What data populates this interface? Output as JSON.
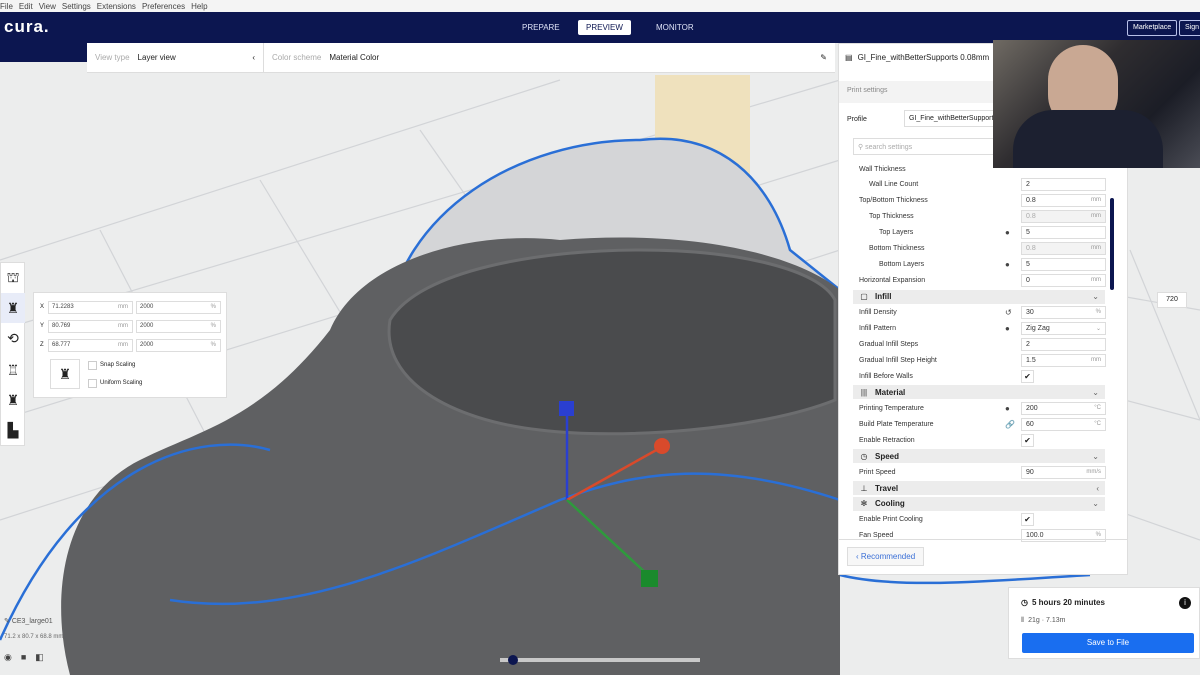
{
  "menu": [
    "File",
    "Edit",
    "View",
    "Settings",
    "Extensions",
    "Preferences",
    "Help"
  ],
  "header": {
    "logo": "cura.",
    "tabs": [
      "PREPARE",
      "PREVIEW",
      "MONITOR"
    ],
    "active_tab": "PREVIEW",
    "marketplace": "Marketplace",
    "signin": "Sign"
  },
  "viewbar": {
    "view_type_label": "View type",
    "view_type": "Layer view",
    "color_scheme_label": "Color scheme",
    "color_scheme": "Material Color"
  },
  "settings": {
    "profile_name": "GI_Fine_withBetterSupports 0.08mm",
    "print_settings": "Print settings",
    "profile_label": "Profile",
    "profile_value": "GI_Fine_withBetterSupports",
    "search_placeholder": "search settings",
    "rows": [
      {
        "type": "s",
        "label": "Wall Thickness",
        "indent": 0
      },
      {
        "type": "s",
        "label": "Wall Line Count",
        "indent": 1,
        "value": "2"
      },
      {
        "type": "s",
        "label": "Top/Bottom Thickness",
        "indent": 0,
        "value": "0.8",
        "unit": "mm"
      },
      {
        "type": "s",
        "label": "Top Thickness",
        "indent": 1,
        "value": "0.8",
        "unit": "mm",
        "disabled": true
      },
      {
        "type": "s",
        "label": "Top Layers",
        "indent": 2,
        "value": "5",
        "icon": "●"
      },
      {
        "type": "s",
        "label": "Bottom Thickness",
        "indent": 1,
        "value": "0.8",
        "unit": "mm",
        "disabled": true
      },
      {
        "type": "s",
        "label": "Bottom Layers",
        "indent": 2,
        "value": "5",
        "icon": "●"
      },
      {
        "type": "s",
        "label": "Horizontal Expansion",
        "indent": 0,
        "value": "0",
        "unit": "mm"
      },
      {
        "type": "c",
        "label": "Infill",
        "icon": "▢",
        "chev": "⌄"
      },
      {
        "type": "s",
        "label": "Infill Density",
        "indent": 0,
        "value": "30",
        "unit": "%",
        "icon": "↺"
      },
      {
        "type": "s",
        "label": "Infill Pattern",
        "indent": 0,
        "value": "Zig Zag",
        "unit": "⌄",
        "icon": "●"
      },
      {
        "type": "s",
        "label": "Gradual Infill Steps",
        "indent": 0,
        "value": "2"
      },
      {
        "type": "s",
        "label": "Gradual Infill Step Height",
        "indent": 0,
        "value": "1.5",
        "unit": "mm"
      },
      {
        "type": "k",
        "label": "Infill Before Walls",
        "check": "✔"
      },
      {
        "type": "c",
        "label": "Material",
        "icon": "|||",
        "chev": "⌄"
      },
      {
        "type": "s",
        "label": "Printing Temperature",
        "indent": 0,
        "value": "200",
        "unit": "°C",
        "icon": "●"
      },
      {
        "type": "s",
        "label": "Build Plate Temperature",
        "indent": 0,
        "value": "60",
        "unit": "°C",
        "icon": "🔗"
      },
      {
        "type": "k",
        "label": "Enable Retraction",
        "check": "✔"
      },
      {
        "type": "c",
        "label": "Speed",
        "icon": "◷",
        "chev": "⌄"
      },
      {
        "type": "s",
        "label": "Print Speed",
        "indent": 0,
        "value": "90",
        "unit": "mm/s"
      },
      {
        "type": "c",
        "label": "Travel",
        "icon": "⊥",
        "chev": "‹"
      },
      {
        "type": "c",
        "label": "Cooling",
        "icon": "✻",
        "chev": "⌄"
      },
      {
        "type": "k",
        "label": "Enable Print Cooling",
        "check": "✔"
      },
      {
        "type": "s",
        "label": "Fan Speed",
        "indent": 0,
        "value": "100.0",
        "unit": "%"
      }
    ],
    "recommended": "Recommended"
  },
  "scale": {
    "rows": [
      {
        "axis": "X",
        "mm": "71.2283",
        "unit": "mm",
        "pct": "2000",
        "pu": "%"
      },
      {
        "axis": "Y",
        "mm": "80.769",
        "unit": "mm",
        "pct": "2000",
        "pu": "%"
      },
      {
        "axis": "Z",
        "mm": "68.777",
        "unit": "mm",
        "pct": "2000",
        "pu": "%"
      }
    ],
    "snap": "Snap Scaling",
    "uniform": "Uniform Scaling"
  },
  "object": {
    "name": "CE3_large01",
    "dims": "71.2 x 80.7 x 68.8 mm"
  },
  "layer": {
    "current": "720"
  },
  "print": {
    "time": "5 hours 20 minutes",
    "material": "21g · 7.13m",
    "save": "Save to File"
  },
  "colors": {
    "header": "#0c1650",
    "accent": "#196ef0",
    "outline": "#2a6fd6"
  }
}
